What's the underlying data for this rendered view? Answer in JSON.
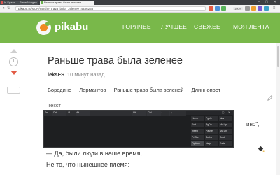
{
  "browser": {
    "tabs": [
      {
        "label": "Is Space — Steve Morgan"
      },
      {
        "label": "Раньше трава была зеленее"
      }
    ],
    "url": "pikabu.ru/story/ranshe_trava_byila_zelenee_4336268",
    "badge": "100%"
  },
  "header": {
    "logo": "pikabu",
    "nav": [
      "ГОРЯЧЕЕ",
      "ЛУЧШЕЕ",
      "СВЕЖЕЕ",
      "МОЯ ЛЕНТА"
    ]
  },
  "story": {
    "title": "Раньше трава была зеленее",
    "author": "leksFS",
    "time": "10 минут назад",
    "tags": [
      "Бородино",
      "Лермантов",
      "Раньше трава была зеленей",
      "Длиннопост"
    ],
    "text_label": "Текст",
    "partial_right": "ино\",",
    "line1": "— Да, были люди в наше время,",
    "line2": "Не то, что нынешнее племя:"
  },
  "rail": {
    "more": "···"
  },
  "keyboard": {
    "title": "Экранная клавиатура",
    "rows": [
      [
        "Esc",
        "~",
        "1",
        "2",
        "3",
        "4",
        "5",
        "6",
        "7",
        "8",
        "9",
        "0",
        "-",
        "=",
        "Bksp"
      ],
      [
        "Tab",
        "q",
        "w",
        "e",
        "r",
        "t",
        "y",
        "u",
        "i",
        "o",
        "p",
        "[",
        "]",
        "\\",
        "Del"
      ],
      [
        "Caps",
        "a",
        "s",
        "d",
        "f",
        "g",
        "h",
        "j",
        "k",
        "l",
        ";",
        "'",
        "Enter"
      ],
      [
        "Shift",
        "z",
        "x",
        "c",
        "v",
        "b",
        "n",
        "m",
        ",",
        ".",
        "/",
        "↑",
        "Shift"
      ],
      [
        "Fn",
        "Ctrl",
        "⊞",
        "Alt",
        "",
        "Alt",
        "Ctrl",
        "←",
        "↓",
        "→"
      ]
    ],
    "side": [
      [
        "Home",
        "PgUp",
        "Nav"
      ],
      [
        "End",
        "PgDn",
        "Mv Up"
      ],
      [
        "Insert",
        "Pause",
        "Mv Dn"
      ],
      [
        "PrtScn",
        "ScrLk",
        "Dock"
      ],
      [
        "Options",
        "Help",
        "Fade"
      ]
    ]
  },
  "colors": {
    "brand_green": "#79b84a",
    "logo_orange": "#f08a24",
    "downvote_red": "#e25b45"
  }
}
